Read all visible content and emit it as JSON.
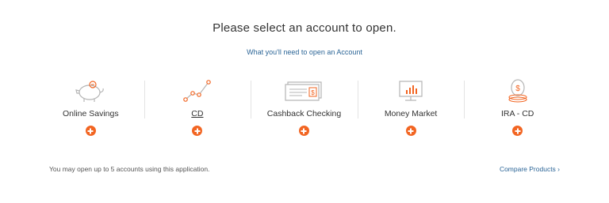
{
  "header": {
    "title": "Please select an account to open.",
    "needs_link": "What you'll need to open an Account"
  },
  "accounts": [
    {
      "label": "Online Savings",
      "icon": "piggy-bank-icon",
      "underlined": false
    },
    {
      "label": "CD",
      "icon": "growth-line-icon",
      "underlined": true
    },
    {
      "label": "Cashback Checking",
      "icon": "check-icon",
      "underlined": false
    },
    {
      "label": "Money Market",
      "icon": "monitor-chart-icon",
      "underlined": false
    },
    {
      "label": "IRA - CD",
      "icon": "egg-dollar-icon",
      "underlined": false
    }
  ],
  "footer": {
    "note": "You may open up to 5 accounts using this application.",
    "compare_label": "Compare Products ›"
  },
  "colors": {
    "accent": "#f26522",
    "link": "#2a6496",
    "icon_gray": "#b5b5b5"
  }
}
